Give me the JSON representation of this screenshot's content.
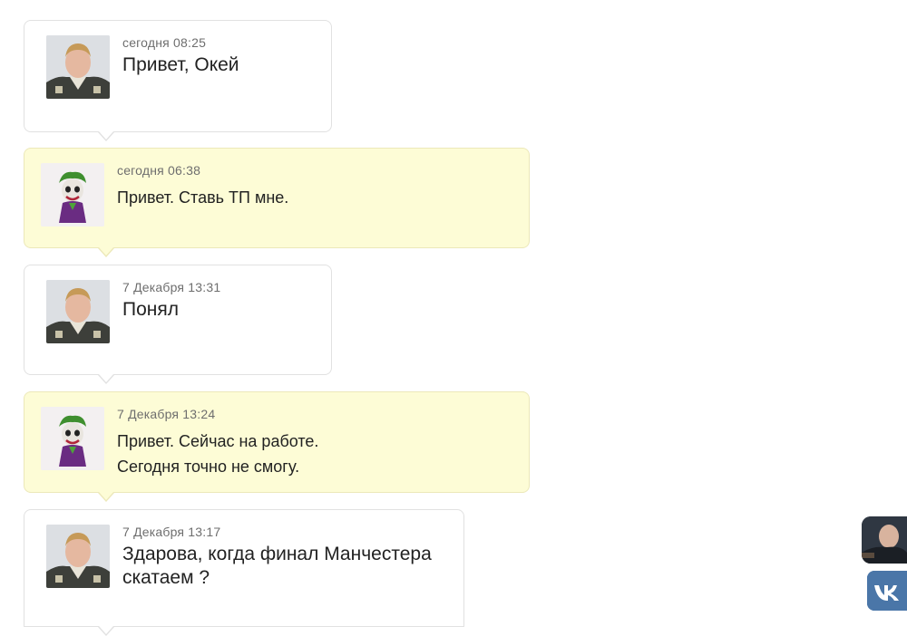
{
  "messages": [
    {
      "author_type": "me",
      "time": "сегодня 08:25",
      "lines": [
        "Привет, Окей"
      ]
    },
    {
      "author_type": "them",
      "time": "сегодня 06:38",
      "lines": [
        "Привет. Ставь ТП мне."
      ]
    },
    {
      "author_type": "me",
      "time": "7 Декабря 13:31",
      "lines": [
        "Понял"
      ]
    },
    {
      "author_type": "them",
      "time": "7 Декабря 13:24",
      "lines": [
        "Привет. Сейчас на работе.",
        "Сегодня точно не смогу."
      ]
    },
    {
      "author_type": "me",
      "time": "7 Декабря 13:17",
      "lines": [
        "Здарова, когда финал Манчестера",
        "скатаем ?"
      ]
    }
  ],
  "colors": {
    "my_bubble": "#ffffff",
    "their_bubble": "#fdfcd6",
    "vk_blue": "#4a76a8"
  },
  "icons": {
    "my_avatar": "person-photo-avatar",
    "their_avatar": "joker-avatar",
    "vk": "vk-logo-icon"
  }
}
